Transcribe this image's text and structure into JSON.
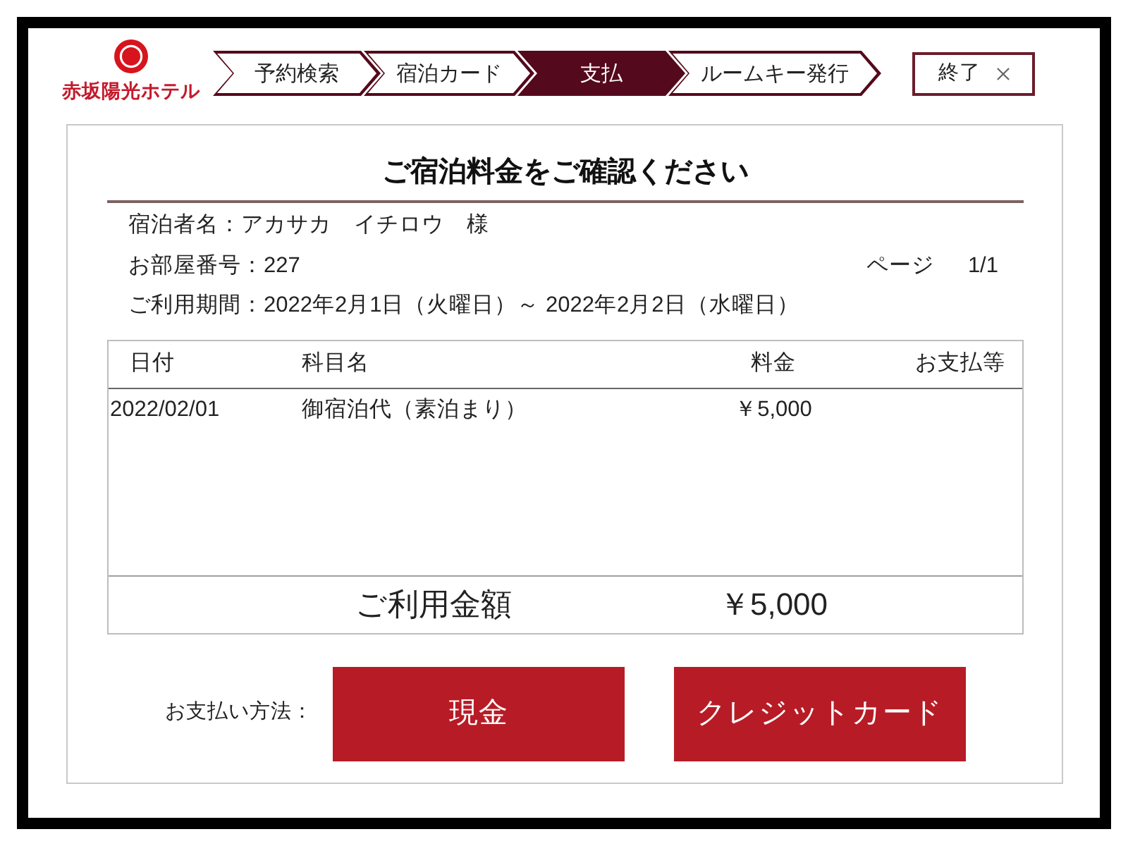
{
  "hotel": {
    "name": "赤坂陽光ホテル"
  },
  "steps": [
    {
      "label": "予約検索",
      "selected": false
    },
    {
      "label": "宿泊カード",
      "selected": false
    },
    {
      "label": "支払",
      "selected": true
    },
    {
      "label": "ルームキー発行",
      "selected": false
    }
  ],
  "exit_button": {
    "label": "終了"
  },
  "title": "ご宿泊料金をご確認ください",
  "guest": {
    "label": "宿泊者名：",
    "value": "アカサカ　イチロウ　様"
  },
  "room": {
    "label": "お部屋番号：",
    "value": "227"
  },
  "page": {
    "label": "ページ",
    "value": "1/1"
  },
  "period": {
    "label": "ご利用期間：",
    "value": "2022年2月1日（火曜日）～ 2022年2月2日（水曜日）"
  },
  "table": {
    "columns": [
      "日付",
      "科目名",
      "料金",
      "お支払等"
    ],
    "rows": [
      {
        "date": "2022/02/01",
        "item": "御宿泊代（素泊まり）",
        "amount": "￥5,000"
      }
    ],
    "total": {
      "label": "ご利用金額",
      "amount": "￥5,000"
    }
  },
  "payment": {
    "label": "お支払い方法：",
    "buttons": [
      "現金",
      "クレジットカード"
    ]
  }
}
